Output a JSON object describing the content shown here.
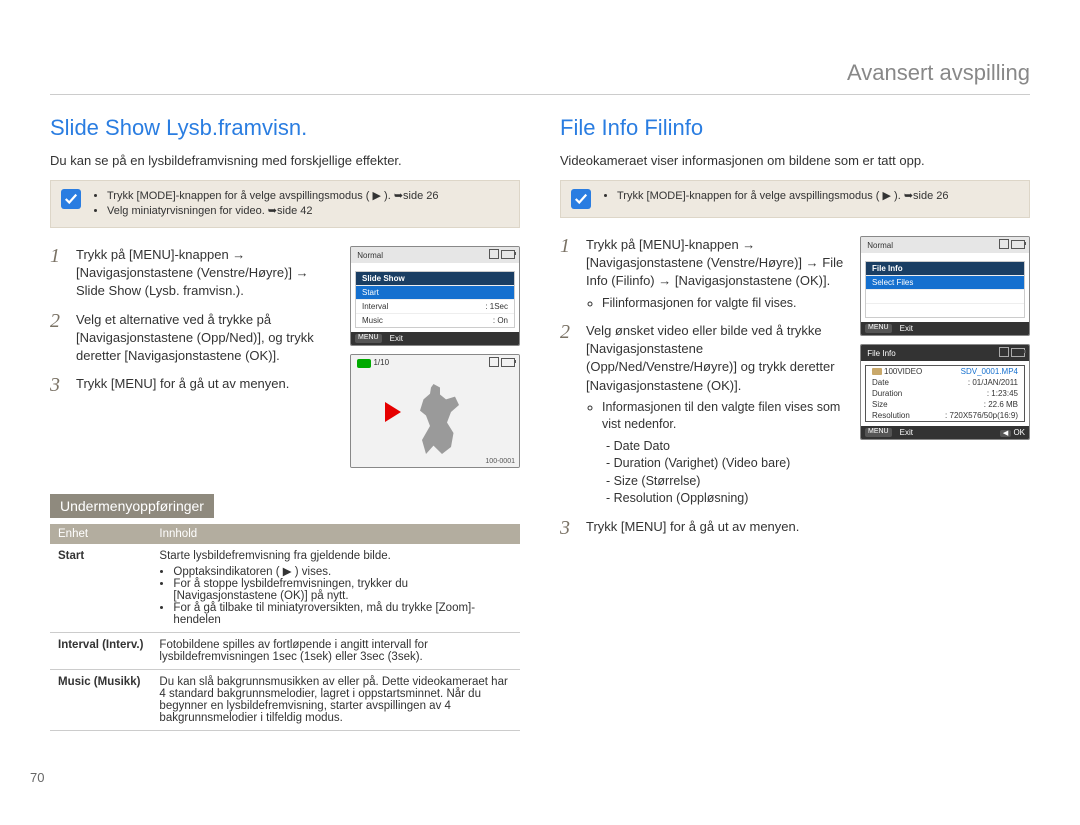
{
  "header": {
    "title": "Avansert avspilling"
  },
  "page_number": "70",
  "left": {
    "title": "Slide Show Lysb.framvisn.",
    "intro": "Du kan se på en lysbildeframvisning med forskjellige effekter.",
    "tip": {
      "items": [
        "Trykk [MODE]-knappen for å velge avspillingsmodus ( ▶ ). ➥side 26",
        "Velg miniatyrvisningen for video. ➥side 42"
      ]
    },
    "steps": [
      {
        "num": "1",
        "text": "Trykk på [MENU]-knappen → [Navigasjonstastene (Venstre/Høyre)] → Slide Show (Lysb. framvisn.)."
      },
      {
        "num": "2",
        "text": "Velg et alternative ved å trykke på [Navigasjonstastene (Opp/Ned)], og trykk deretter [Navigasjonstastene (OK)]."
      },
      {
        "num": "3",
        "text": "Trykk [MENU] for å gå ut av menyen."
      }
    ],
    "sub_heading": "Undermenyoppføringer",
    "table": {
      "headers": [
        "Enhet",
        "Innhold"
      ],
      "rows": [
        {
          "k": "Start",
          "v_intro": "Starte lysbildefremvisning fra gjeldende bilde.",
          "v_items": [
            "Opptaksindikatoren ( ▶ ) vises.",
            "For å stoppe lysbildefremvisningen, trykker du [Navigasjonstastene (OK)] på nytt.",
            "For å gå tilbake til miniatyroversikten, må du trykke [Zoom]-hendelen"
          ]
        },
        {
          "k": "Interval (Interv.)",
          "v_intro": "Fotobildene spilles av fortløpende i angitt intervall for lysbildefremvisningen 1sec (1sek) eller 3sec (3sek)."
        },
        {
          "k": "Music (Musikk)",
          "v_intro": "Du kan slå bakgrunnsmusikken av eller på. Dette videokameraet har 4 standard bakgrunnsmelodier, lagret i oppstartsminnet. Når du begynner en lysbildefremvisning, starter avspillingen av 4 bakgrunnsmelodier i tilfeldig modus."
        }
      ]
    },
    "screen1": {
      "normal": "Normal",
      "menu_title": "Slide Show",
      "rows": [
        {
          "label": "Start",
          "val": ""
        },
        {
          "label": "Interval",
          "val": ": 1Sec"
        },
        {
          "label": "Music",
          "val": ": On"
        }
      ],
      "footer_menu": "MENU",
      "footer_exit": "Exit"
    },
    "screen2": {
      "counter": "1/10",
      "fileno": "100-0001"
    }
  },
  "right": {
    "title": "File Info Filinfo",
    "intro": "Videokameraet viser informasjonen om bildene som er tatt opp.",
    "tip": {
      "items": [
        "Trykk [MODE]-knappen for å velge avspillingsmodus ( ▶ ). ➥side 26"
      ]
    },
    "steps": [
      {
        "num": "1",
        "text": "Trykk på [MENU]-knappen → [Navigasjonstastene (Venstre/Høyre)] → File Info (Filinfo) → [Navigasjonstastene (OK)].",
        "bullets": [
          "Filinformasjonen for valgte fil vises."
        ]
      },
      {
        "num": "2",
        "text": "Velg ønsket video eller bilde ved å trykke [Navigasjonstastene (Opp/Ned/Venstre/Høyre)] og trykk deretter [Navigasjonstastene (OK)].",
        "bullets_intro": "Informasjonen til den valgte filen vises som vist nedenfor.",
        "dash": [
          "Date Dato",
          "Duration (Varighet) (Video bare)",
          "Size (Størrelse)",
          "Resolution (Oppløsning)"
        ]
      },
      {
        "num": "3",
        "text": "Trykk [MENU] for å gå ut av menyen."
      }
    ],
    "screen1": {
      "normal": "Normal",
      "menu_title": "File Info",
      "row_sel": "Select Files",
      "footer_menu": "MENU",
      "footer_exit": "Exit"
    },
    "screen2": {
      "title": "File Info",
      "folder": "100VIDEO",
      "file": "SDV_0001.MP4",
      "rows": [
        {
          "k": "Date",
          "v": ": 01/JAN/2011"
        },
        {
          "k": "Duration",
          "v": ": 1:23:45"
        },
        {
          "k": "Size",
          "v": ": 22.6 MB"
        },
        {
          "k": "Resolution",
          "v": ": 720X576/50p(16:9)"
        }
      ],
      "footer_menu": "MENU",
      "footer_exit": "Exit",
      "footer_ok_tag": "◀",
      "footer_ok": "OK"
    }
  }
}
